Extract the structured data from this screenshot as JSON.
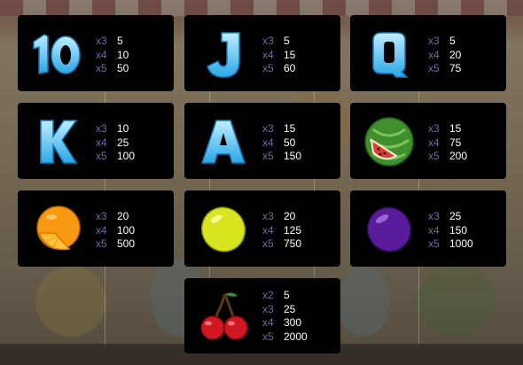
{
  "colors": {
    "card_bg": "#000000",
    "multiplier_text": "#6f6aa8",
    "amount_text": "#ffffff"
  },
  "paytable": [
    {
      "symbol": "10",
      "icon": "ten-icon",
      "pays": [
        {
          "mult": "x3",
          "amount": "5"
        },
        {
          "mult": "x4",
          "amount": "10"
        },
        {
          "mult": "x5",
          "amount": "50"
        }
      ]
    },
    {
      "symbol": "J",
      "icon": "letter-j-icon",
      "pays": [
        {
          "mult": "x3",
          "amount": "5"
        },
        {
          "mult": "x4",
          "amount": "15"
        },
        {
          "mult": "x5",
          "amount": "60"
        }
      ]
    },
    {
      "symbol": "Q",
      "icon": "letter-q-icon",
      "pays": [
        {
          "mult": "x3",
          "amount": "5"
        },
        {
          "mult": "x4",
          "amount": "20"
        },
        {
          "mult": "x5",
          "amount": "75"
        }
      ]
    },
    {
      "symbol": "K",
      "icon": "letter-k-icon",
      "pays": [
        {
          "mult": "x3",
          "amount": "10"
        },
        {
          "mult": "x4",
          "amount": "25"
        },
        {
          "mult": "x5",
          "amount": "100"
        }
      ]
    },
    {
      "symbol": "A",
      "icon": "letter-a-icon",
      "pays": [
        {
          "mult": "x3",
          "amount": "15"
        },
        {
          "mult": "x4",
          "amount": "50"
        },
        {
          "mult": "x5",
          "amount": "150"
        }
      ]
    },
    {
      "symbol": "Watermelon",
      "icon": "watermelon-icon",
      "pays": [
        {
          "mult": "x3",
          "amount": "15"
        },
        {
          "mult": "x4",
          "amount": "75"
        },
        {
          "mult": "x5",
          "amount": "200"
        }
      ]
    },
    {
      "symbol": "Orange",
      "icon": "orange-icon",
      "pays": [
        {
          "mult": "x3",
          "amount": "20"
        },
        {
          "mult": "x4",
          "amount": "100"
        },
        {
          "mult": "x5",
          "amount": "500"
        }
      ]
    },
    {
      "symbol": "Lemon",
      "icon": "lemon-icon",
      "pays": [
        {
          "mult": "x3",
          "amount": "20"
        },
        {
          "mult": "x4",
          "amount": "125"
        },
        {
          "mult": "x5",
          "amount": "750"
        }
      ]
    },
    {
      "symbol": "Plum",
      "icon": "plum-icon",
      "pays": [
        {
          "mult": "x3",
          "amount": "25"
        },
        {
          "mult": "x4",
          "amount": "150"
        },
        {
          "mult": "x5",
          "amount": "1000"
        }
      ]
    },
    {
      "symbol": "Cherry",
      "icon": "cherry-icon",
      "pays": [
        {
          "mult": "x2",
          "amount": "5"
        },
        {
          "mult": "x3",
          "amount": "25"
        },
        {
          "mult": "x4",
          "amount": "300"
        },
        {
          "mult": "x5",
          "amount": "2000"
        }
      ]
    }
  ]
}
